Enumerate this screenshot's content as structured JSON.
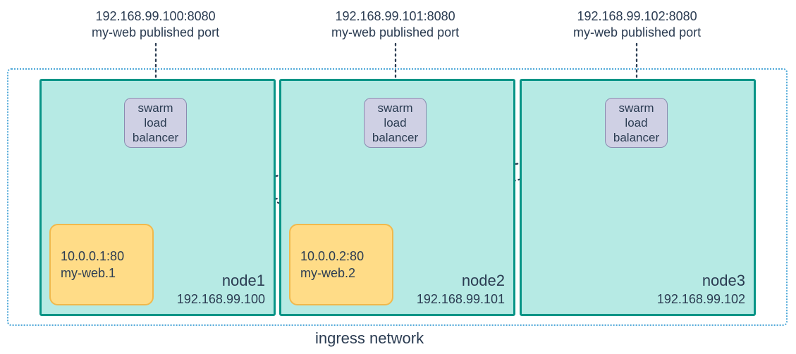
{
  "ingress": {
    "caption": "ingress network"
  },
  "nodes": [
    {
      "ext_addr": "192.168.99.100:8080",
      "ext_sub": "my-web published port",
      "lb_l1": "swarm",
      "lb_l2": "load",
      "lb_l3": "balancer",
      "name": "node1",
      "ip": "192.168.99.100",
      "task_addr": "10.0.0.1:80",
      "task_name": "my-web.1"
    },
    {
      "ext_addr": "192.168.99.101:8080",
      "ext_sub": "my-web published port",
      "lb_l1": "swarm",
      "lb_l2": "load",
      "lb_l3": "balancer",
      "name": "node2",
      "ip": "192.168.99.101",
      "task_addr": "10.0.0.2:80",
      "task_name": "my-web.2"
    },
    {
      "ext_addr": "192.168.99.102:8080",
      "ext_sub": "my-web published port",
      "lb_l1": "swarm",
      "lb_l2": "load",
      "lb_l3": "balancer",
      "name": "node3",
      "ip": "192.168.99.102"
    }
  ]
}
